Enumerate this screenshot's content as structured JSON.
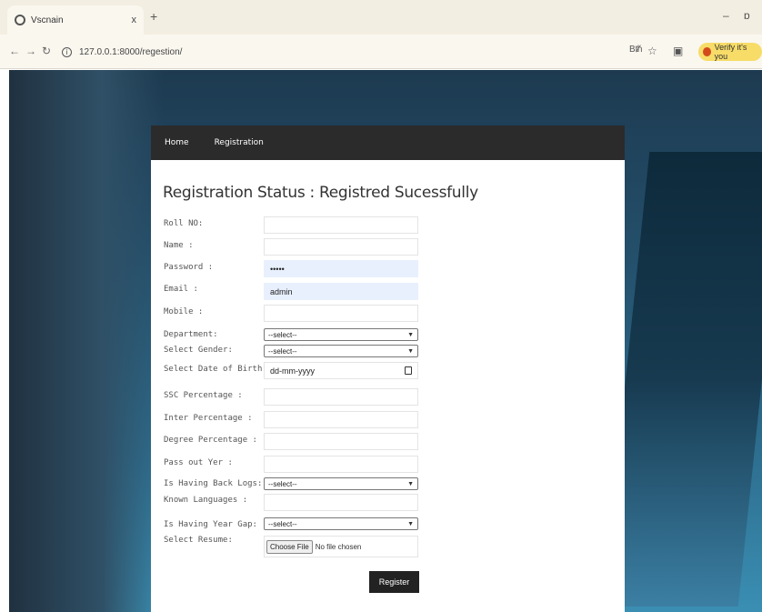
{
  "browser": {
    "tab_title": "Vscnain",
    "tab_close": "x",
    "new_tab": "+",
    "minimize": "–",
    "restore": "ɒ",
    "url": "127.0.0.1:8000/regestion/",
    "verify_label": "Verify it's you",
    "translate_icon": "Bᵺ"
  },
  "nav": {
    "home": "Home",
    "registration": "Registration"
  },
  "page": {
    "status_message": "Registration Status : Registred Sucessfully"
  },
  "form": {
    "roll_label": "Roll NO:",
    "name_label": "Name :",
    "password_label": "Password :",
    "password_value": "•••••",
    "email_label": "Email :",
    "email_value": "admin",
    "mobile_label": "Mobile :",
    "department_label": "Department:",
    "department_value": "--select--",
    "gender_label": "Select Gender:",
    "gender_value": "--select--",
    "dob_label": "Select Date of Birth :",
    "dob_placeholder": "dd-mm-yyyy",
    "ssc_label": "SSC Percentage :",
    "inter_label": "Inter Percentage :",
    "degree_label": "Degree Percentage :",
    "passout_label": "Pass out Yer :",
    "backlog_label": "Is Having Back Logs:",
    "backlog_value": "--select--",
    "languages_label": "Known Languages :",
    "yeargap_label": "Is Having Year Gap:",
    "yeargap_value": "--select--",
    "resume_label": "Select Resume:",
    "choose_file": "Choose File",
    "no_file": "No file chosen",
    "register_button": "Register"
  }
}
